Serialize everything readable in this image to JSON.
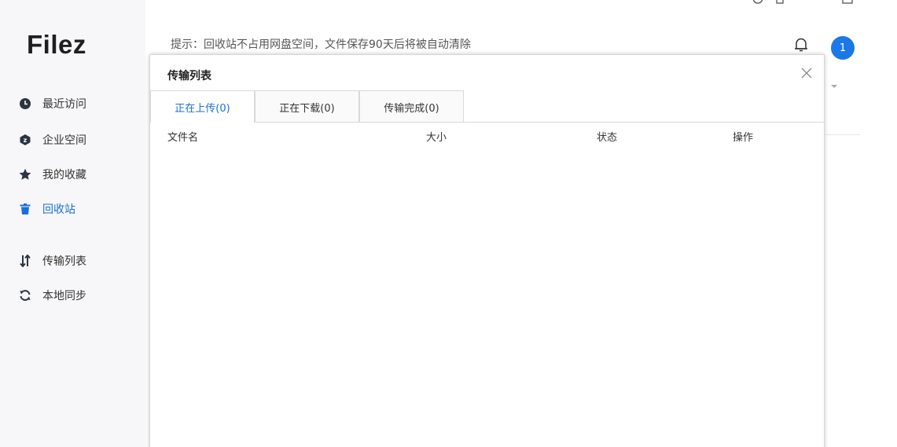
{
  "app": {
    "logo": "Filez"
  },
  "sidebar": {
    "items": [
      {
        "label": "最近访问",
        "icon": "clock-icon",
        "active": false
      },
      {
        "label": "企业空间",
        "icon": "hexagon-icon",
        "active": false
      },
      {
        "label": "我的收藏",
        "icon": "star-icon",
        "active": false
      },
      {
        "label": "回收站",
        "icon": "trash-icon",
        "active": true
      },
      {
        "label": "传输列表",
        "icon": "transfer-icon",
        "active": false
      },
      {
        "label": "本地同步",
        "icon": "sync-icon",
        "active": false
      }
    ]
  },
  "header": {
    "hint": "提示：回收站不占用网盘空间，文件保存90天后将被自动清除",
    "notification_count": "1"
  },
  "modal": {
    "title": "传输列表",
    "tabs": [
      {
        "label": "正在上传(0)",
        "active": true
      },
      {
        "label": "正在下载(0)",
        "active": false
      },
      {
        "label": "传输完成(0)",
        "active": false
      }
    ],
    "columns": [
      "文件名",
      "大小",
      "状态",
      "操作"
    ]
  },
  "colors": {
    "accent": "#1b6fd8",
    "badge": "#1b78e6",
    "sidebar_bg": "#f7f7f9",
    "icon_dark": "#2b3440"
  }
}
